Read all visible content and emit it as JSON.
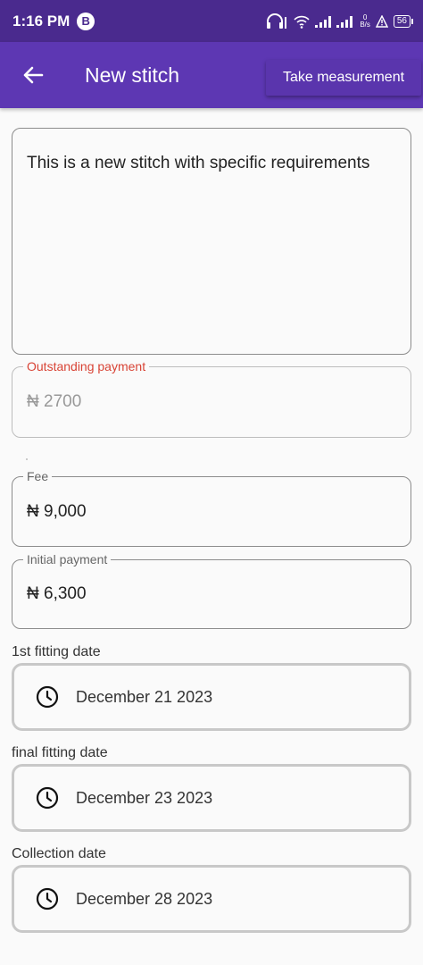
{
  "status_bar": {
    "time": "1:16 PM",
    "badge": "B",
    "net_speed_value": "0",
    "net_speed_unit": "B/s",
    "battery": "56"
  },
  "app_bar": {
    "title": "New stitch",
    "action_label": "Take measurement",
    "back_icon": "arrow-back-icon"
  },
  "form": {
    "notes_value": "This is a new stitch with specific requirements",
    "outstanding": {
      "label": "Outstanding payment",
      "value": "₦ 2700"
    },
    "fee": {
      "label": "Fee",
      "value": "₦ 9,000"
    },
    "initial_payment": {
      "label": "Initial payment",
      "value": "₦ 6,300"
    },
    "first_fitting": {
      "label": "1st fitting date",
      "value": "December 21 2023"
    },
    "final_fitting": {
      "label": "final fitting date",
      "value": "December 23 2023"
    },
    "collection": {
      "label": "Collection date",
      "value": "December 28 2023"
    }
  },
  "colors": {
    "status_bar": "#4a2a8e",
    "app_bar": "#5d37b3",
    "error_label": "#d84335",
    "background": "#fafafa"
  }
}
